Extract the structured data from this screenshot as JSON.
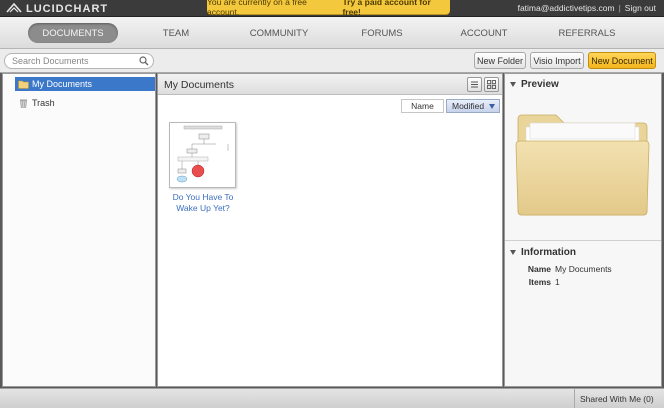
{
  "brand": {
    "name": "LUCIDCHART"
  },
  "banner": {
    "text": "You are currently on a free account.",
    "cta": "Try a paid account for free!"
  },
  "user": {
    "email": "fatima@addictivetips.com",
    "separator": "|",
    "signout": "Sign out"
  },
  "nav": {
    "items": [
      {
        "label": "DOCUMENTS",
        "active": true
      },
      {
        "label": "TEAM"
      },
      {
        "label": "COMMUNITY"
      },
      {
        "label": "FORUMS"
      },
      {
        "label": "ACCOUNT"
      },
      {
        "label": "REFERRALS"
      }
    ]
  },
  "toolbar": {
    "search_placeholder": "Search Documents",
    "new_folder": "New Folder",
    "visio_import": "Visio Import",
    "new_document": "New Document"
  },
  "tree": {
    "items": [
      {
        "label": "My Documents",
        "selected": true,
        "icon": "folder-icon"
      },
      {
        "label": "Trash",
        "icon": "trash-icon"
      }
    ]
  },
  "main": {
    "title": "My Documents",
    "sort": {
      "name": "Name",
      "modified": "Modified"
    },
    "documents": [
      {
        "title": "Do You Have To Wake Up Yet?"
      }
    ]
  },
  "preview": {
    "title": "Preview"
  },
  "information": {
    "title": "Information",
    "rows": [
      {
        "key": "Name",
        "value": "My Documents"
      },
      {
        "key": "Items",
        "value": "1"
      }
    ]
  },
  "status": {
    "shared": "Shared With Me (0)"
  },
  "colors": {
    "accent": "#f4b51c",
    "selection": "#3c78c9",
    "link": "#3c6fbf",
    "banner": "#f3c83d"
  }
}
